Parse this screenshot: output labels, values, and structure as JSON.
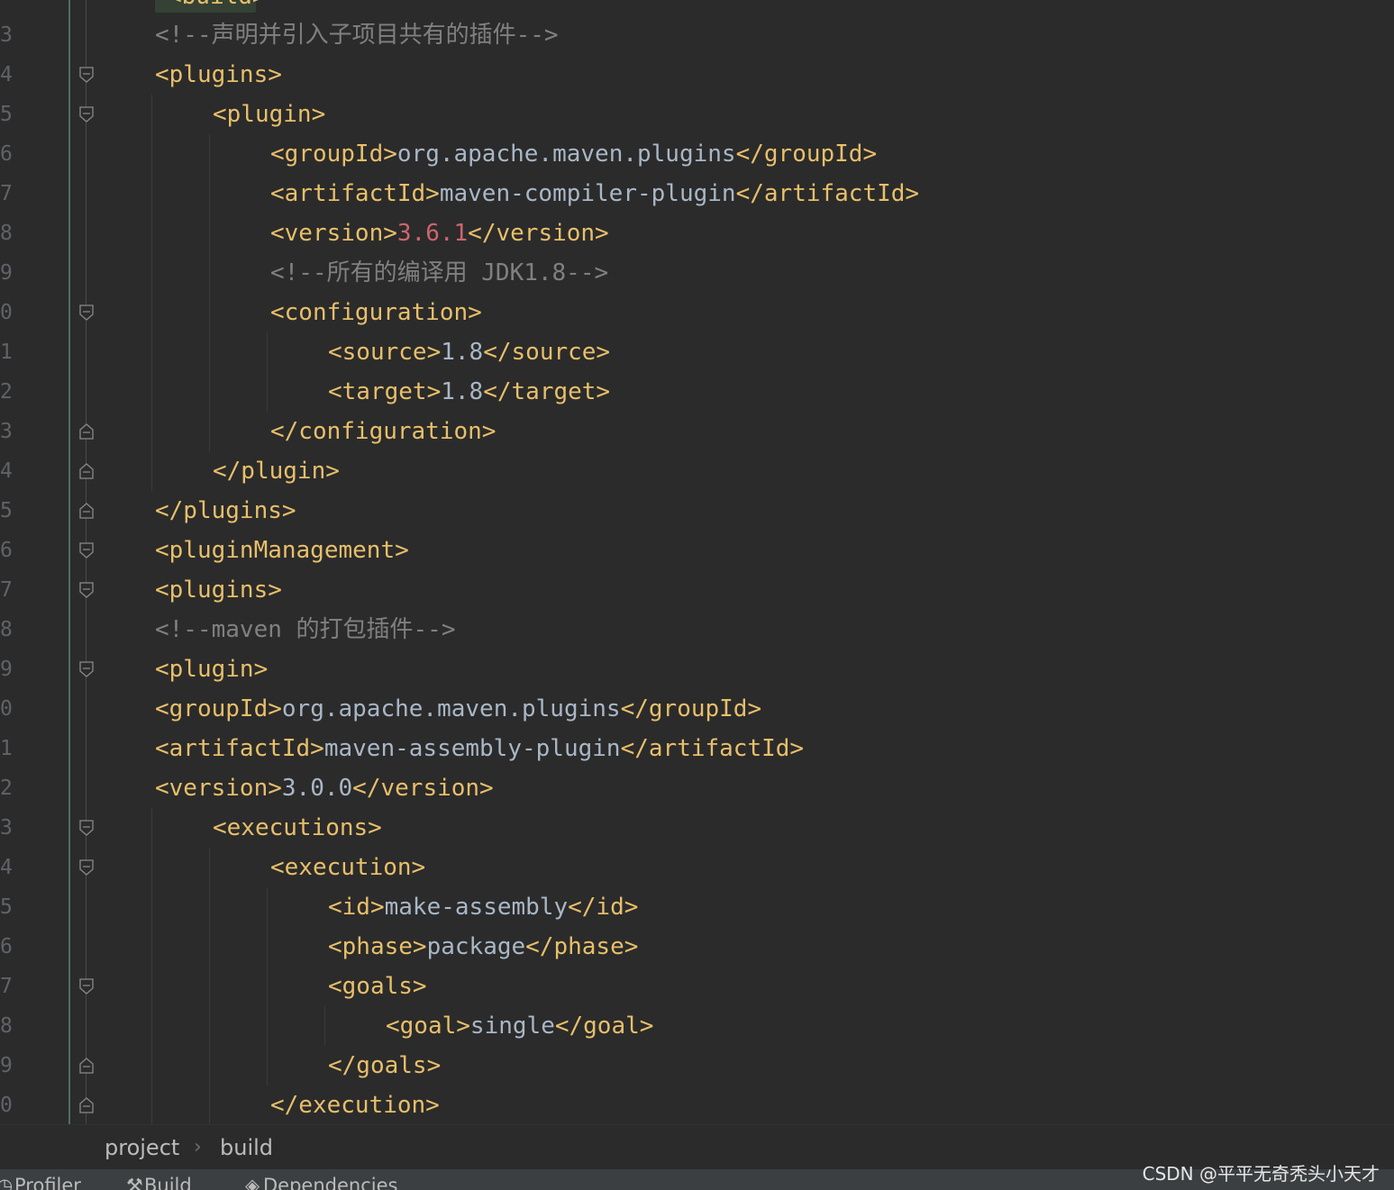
{
  "editor": {
    "top_partial_tag": "<build>",
    "lines": [
      {
        "no": "3",
        "fold": "",
        "indent": 0,
        "parts": [
          [
            "cmt",
            "<!--声明并引入子项目共有的插件-->"
          ]
        ]
      },
      {
        "no": "4",
        "fold": "open",
        "indent": 0,
        "parts": [
          [
            "tag",
            "<plugins>"
          ]
        ]
      },
      {
        "no": "5",
        "fold": "open",
        "indent": 1,
        "parts": [
          [
            "tag",
            "<plugin>"
          ]
        ]
      },
      {
        "no": "6",
        "fold": "",
        "indent": 2,
        "parts": [
          [
            "tag",
            "<groupId>"
          ],
          [
            "txt",
            "org.apache.maven.plugins"
          ],
          [
            "tag",
            "</groupId>"
          ]
        ]
      },
      {
        "no": "7",
        "fold": "",
        "indent": 2,
        "parts": [
          [
            "tag",
            "<artifactId>"
          ],
          [
            "txt",
            "maven-compiler-plugin"
          ],
          [
            "tag",
            "</artifactId>"
          ]
        ]
      },
      {
        "no": "8",
        "fold": "",
        "indent": 2,
        "parts": [
          [
            "tag",
            "<version>"
          ],
          [
            "num",
            "3.6.1"
          ],
          [
            "tag",
            "</version>"
          ]
        ]
      },
      {
        "no": "9",
        "fold": "",
        "indent": 2,
        "parts": [
          [
            "cmt",
            "<!--所有的编译用 JDK1.8-->"
          ]
        ]
      },
      {
        "no": "0",
        "fold": "open",
        "indent": 2,
        "parts": [
          [
            "tag",
            "<configuration>"
          ]
        ]
      },
      {
        "no": "1",
        "fold": "",
        "indent": 3,
        "parts": [
          [
            "tag",
            "<source>"
          ],
          [
            "txt",
            "1.8"
          ],
          [
            "tag",
            "</source>"
          ]
        ]
      },
      {
        "no": "2",
        "fold": "",
        "indent": 3,
        "parts": [
          [
            "tag",
            "<target>"
          ],
          [
            "txt",
            "1.8"
          ],
          [
            "tag",
            "</target>"
          ]
        ]
      },
      {
        "no": "3",
        "fold": "close",
        "indent": 2,
        "parts": [
          [
            "tag",
            "</configuration>"
          ]
        ]
      },
      {
        "no": "4",
        "fold": "close",
        "indent": 1,
        "parts": [
          [
            "tag",
            "</plugin>"
          ]
        ]
      },
      {
        "no": "5",
        "fold": "close",
        "indent": 0,
        "parts": [
          [
            "tag",
            "</plugins>"
          ]
        ]
      },
      {
        "no": "6",
        "fold": "open",
        "indent": 0,
        "parts": [
          [
            "tag",
            "<pluginManagement>"
          ]
        ]
      },
      {
        "no": "7",
        "fold": "open",
        "indent": 0,
        "parts": [
          [
            "tag",
            "<plugins>"
          ]
        ]
      },
      {
        "no": "8",
        "fold": "",
        "indent": 0,
        "parts": [
          [
            "cmt",
            "<!--maven 的打包插件-->"
          ]
        ]
      },
      {
        "no": "9",
        "fold": "open",
        "indent": 0,
        "parts": [
          [
            "tag",
            "<plugin>"
          ]
        ]
      },
      {
        "no": "0",
        "fold": "",
        "indent": 0,
        "parts": [
          [
            "tag",
            "<groupId>"
          ],
          [
            "txt",
            "org.apache.maven.plugins"
          ],
          [
            "tag",
            "</groupId>"
          ]
        ]
      },
      {
        "no": "1",
        "fold": "",
        "indent": 0,
        "parts": [
          [
            "tag",
            "<artifactId>"
          ],
          [
            "txt",
            "maven-assembly-plugin"
          ],
          [
            "tag",
            "</artifactId>"
          ]
        ]
      },
      {
        "no": "2",
        "fold": "",
        "indent": 0,
        "parts": [
          [
            "tag",
            "<version>"
          ],
          [
            "txt",
            "3.0.0"
          ],
          [
            "tag",
            "</version>"
          ]
        ]
      },
      {
        "no": "3",
        "fold": "open",
        "indent": 1,
        "parts": [
          [
            "tag",
            "<executions>"
          ]
        ]
      },
      {
        "no": "4",
        "fold": "open",
        "indent": 2,
        "parts": [
          [
            "tag",
            "<execution>"
          ]
        ]
      },
      {
        "no": "5",
        "fold": "",
        "indent": 3,
        "parts": [
          [
            "tag",
            "<id>"
          ],
          [
            "txt",
            "make-assembly"
          ],
          [
            "tag",
            "</id>"
          ]
        ]
      },
      {
        "no": "6",
        "fold": "",
        "indent": 3,
        "parts": [
          [
            "tag",
            "<phase>"
          ],
          [
            "txt",
            "package"
          ],
          [
            "tag",
            "</phase>"
          ]
        ]
      },
      {
        "no": "7",
        "fold": "open",
        "indent": 3,
        "parts": [
          [
            "tag",
            "<goals>"
          ]
        ]
      },
      {
        "no": "8",
        "fold": "",
        "indent": 4,
        "parts": [
          [
            "tag",
            "<goal>"
          ],
          [
            "txt",
            "single"
          ],
          [
            "tag",
            "</goal>"
          ]
        ]
      },
      {
        "no": "9",
        "fold": "close",
        "indent": 3,
        "parts": [
          [
            "tag",
            "</goals>"
          ]
        ]
      },
      {
        "no": "0",
        "fold": "close",
        "indent": 2,
        "parts": [
          [
            "tag",
            "</execution>"
          ]
        ]
      }
    ]
  },
  "breadcrumb": {
    "items": [
      "project",
      "build"
    ],
    "separator": "›"
  },
  "tool_window_bar": {
    "items": [
      {
        "label": "Profiler",
        "icon": "profiler-icon"
      },
      {
        "label": "Build",
        "icon": "hammer-icon"
      },
      {
        "label": "Dependencies",
        "icon": "dependencies-icon"
      }
    ]
  },
  "watermark": "CSDN @平平无奇秃头小天才",
  "colors": {
    "background": "#2b2b2b",
    "tag": "#e8bf6a",
    "text": "#a9b7c6",
    "comment": "#808080",
    "number": "#cc666e",
    "line_number": "#5f6368"
  }
}
